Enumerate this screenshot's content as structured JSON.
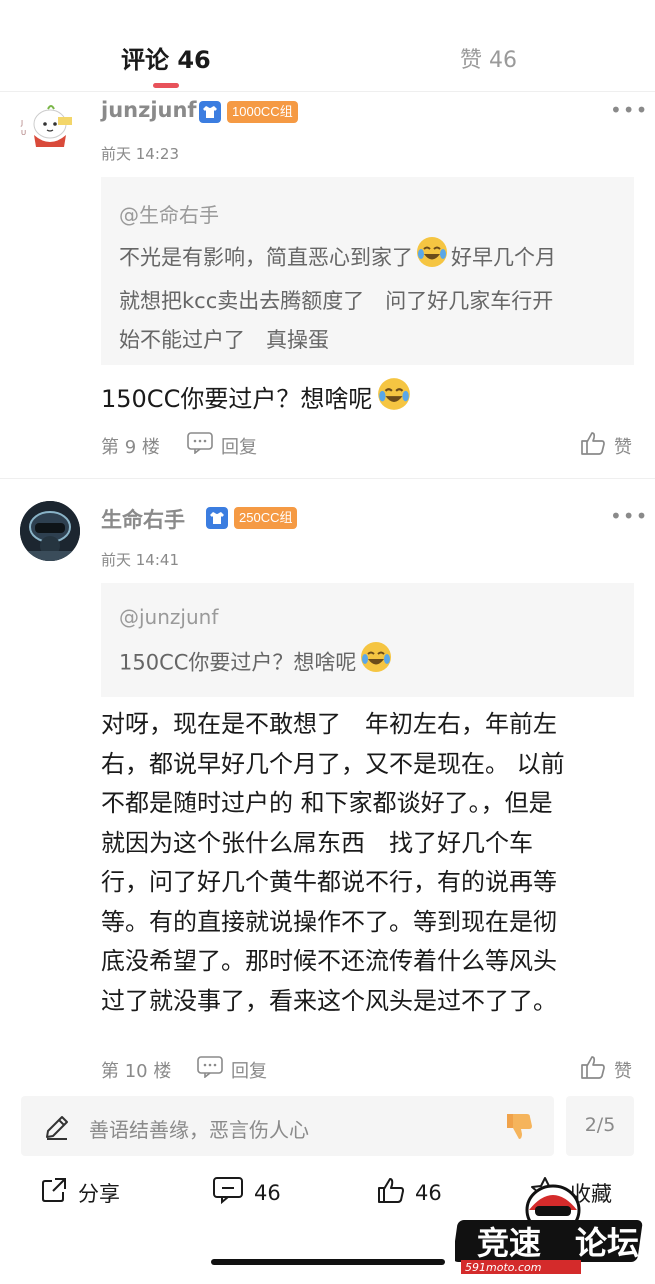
{
  "tabs": {
    "comments_label": "评论 46",
    "likes_label": "赞 46"
  },
  "comments": [
    {
      "username": "junzjunf",
      "level": "1000CC组",
      "time": "前天 14:23",
      "quote_author": "@生命右手",
      "quote_lines": [
        "不光是有影响，简直恶心到家了",
        "好早几个月",
        "就想把kcc卖出去腾额度了　问了好几家车行开",
        "始不能过户了　真操蛋"
      ],
      "body_lines": [
        "150CC你要过户？想啥呢"
      ],
      "floor": "第 9 楼",
      "reply_label": "回复",
      "like_label": "赞"
    },
    {
      "username": "生命右手",
      "level": "250CC组",
      "time": "前天 14:41",
      "quote_author": "@junzjunf",
      "quote_lines": [
        "150CC你要过户？想啥呢"
      ],
      "body_lines": [
        "对呀，现在是不敢想了　年初左右，年前左",
        "右，都说早好几个月了，又不是现在。 以前",
        "不都是随时过户的 和下家都谈好了。，但是",
        "就因为这个张什么屌东西　找了好几个车",
        "行，问了好几个黄牛都说不行，有的说再等",
        "等。有的直接就说操作不了。等到现在是彻",
        "底没希望了。那时候不还流传着什么等风头",
        "过了就没事了，看来这个风头是过不了了。"
      ],
      "floor": "第 10 楼",
      "reply_label": "回复",
      "like_label": "赞"
    }
  ],
  "bottom_bar": {
    "input_placeholder": "善语结善缘，恶言伤人心",
    "page_indicator": "2/5",
    "share_label": "分享",
    "comment_count": "46",
    "like_count": "46",
    "favorite_label": "收藏"
  },
  "watermark": {
    "text": "竞速论坛",
    "sub": "591moto.com"
  },
  "colors": {
    "accent": "#e8525a",
    "badge_orange": "#f59a44",
    "badge_blue": "#3b7de0",
    "grey_text": "#8a8a8a"
  },
  "icons": [
    "more-icon",
    "shirt-icon",
    "laugh-cry-emoji",
    "reply-icon",
    "thumb-up-icon",
    "pencil-icon",
    "thumb-down-icon",
    "share-icon",
    "comment-icon",
    "star-icon"
  ]
}
